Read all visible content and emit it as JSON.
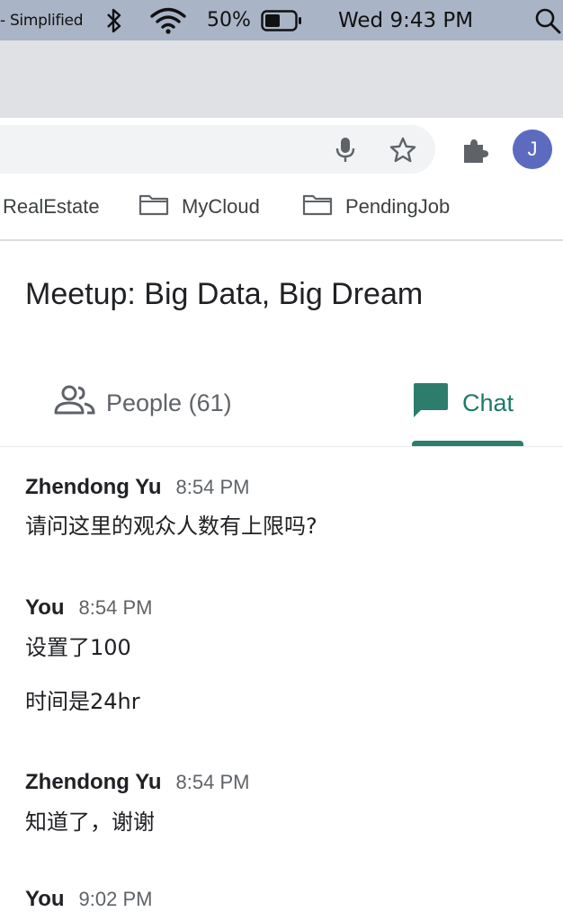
{
  "menubar": {
    "input_source": "- Simplified",
    "battery_percent": "50%",
    "clock": "Wed 9:43 PM"
  },
  "toolbar": {
    "avatar_letter": "J"
  },
  "bookmarks": [
    {
      "label": "RealEstate"
    },
    {
      "label": "MyCloud"
    },
    {
      "label": "PendingJob"
    }
  ],
  "meeting": {
    "title": "Meetup: Big Data, Big Dream"
  },
  "tabs": {
    "people": "People (61)",
    "chat": "Chat"
  },
  "messages": [
    {
      "sender": "Zhendong Yu",
      "time": "8:54 PM",
      "lines": [
        "请问这里的观众人数有上限吗?"
      ]
    },
    {
      "sender": "You",
      "time": "8:54 PM",
      "lines": [
        "设置了100",
        "时间是24hr"
      ]
    },
    {
      "sender": "Zhendong Yu",
      "time": "8:54 PM",
      "lines": [
        "知道了，谢谢"
      ]
    },
    {
      "sender": "You",
      "time": "9:02 PM",
      "lines": []
    }
  ],
  "colors": {
    "menubar_bg": "#a9b4c6",
    "tabstrip_bg": "#dfe1e5",
    "chat_accent": "#1e7a67",
    "avatar_bg": "#5c6bc0"
  }
}
